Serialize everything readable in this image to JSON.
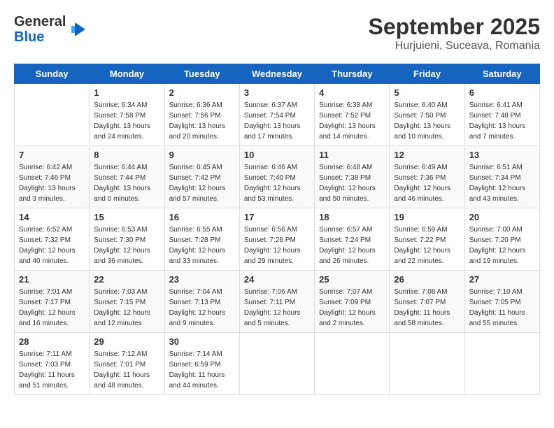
{
  "header": {
    "logo_general": "General",
    "logo_blue": "Blue",
    "month": "September 2025",
    "location": "Hurjuieni, Suceava, Romania"
  },
  "days_of_week": [
    "Sunday",
    "Monday",
    "Tuesday",
    "Wednesday",
    "Thursday",
    "Friday",
    "Saturday"
  ],
  "weeks": [
    [
      {
        "day": "",
        "info": ""
      },
      {
        "day": "1",
        "info": "Sunrise: 6:34 AM\nSunset: 7:58 PM\nDaylight: 13 hours\nand 24 minutes."
      },
      {
        "day": "2",
        "info": "Sunrise: 6:36 AM\nSunset: 7:56 PM\nDaylight: 13 hours\nand 20 minutes."
      },
      {
        "day": "3",
        "info": "Sunrise: 6:37 AM\nSunset: 7:54 PM\nDaylight: 13 hours\nand 17 minutes."
      },
      {
        "day": "4",
        "info": "Sunrise: 6:38 AM\nSunset: 7:52 PM\nDaylight: 13 hours\nand 14 minutes."
      },
      {
        "day": "5",
        "info": "Sunrise: 6:40 AM\nSunset: 7:50 PM\nDaylight: 13 hours\nand 10 minutes."
      },
      {
        "day": "6",
        "info": "Sunrise: 6:41 AM\nSunset: 7:48 PM\nDaylight: 13 hours\nand 7 minutes."
      }
    ],
    [
      {
        "day": "7",
        "info": "Sunrise: 6:42 AM\nSunset: 7:46 PM\nDaylight: 13 hours\nand 3 minutes."
      },
      {
        "day": "8",
        "info": "Sunrise: 6:44 AM\nSunset: 7:44 PM\nDaylight: 13 hours\nand 0 minutes."
      },
      {
        "day": "9",
        "info": "Sunrise: 6:45 AM\nSunset: 7:42 PM\nDaylight: 12 hours\nand 57 minutes."
      },
      {
        "day": "10",
        "info": "Sunrise: 6:46 AM\nSunset: 7:40 PM\nDaylight: 12 hours\nand 53 minutes."
      },
      {
        "day": "11",
        "info": "Sunrise: 6:48 AM\nSunset: 7:38 PM\nDaylight: 12 hours\nand 50 minutes."
      },
      {
        "day": "12",
        "info": "Sunrise: 6:49 AM\nSunset: 7:36 PM\nDaylight: 12 hours\nand 46 minutes."
      },
      {
        "day": "13",
        "info": "Sunrise: 6:51 AM\nSunset: 7:34 PM\nDaylight: 12 hours\nand 43 minutes."
      }
    ],
    [
      {
        "day": "14",
        "info": "Sunrise: 6:52 AM\nSunset: 7:32 PM\nDaylight: 12 hours\nand 40 minutes."
      },
      {
        "day": "15",
        "info": "Sunrise: 6:53 AM\nSunset: 7:30 PM\nDaylight: 12 hours\nand 36 minutes."
      },
      {
        "day": "16",
        "info": "Sunrise: 6:55 AM\nSunset: 7:28 PM\nDaylight: 12 hours\nand 33 minutes."
      },
      {
        "day": "17",
        "info": "Sunrise: 6:56 AM\nSunset: 7:26 PM\nDaylight: 12 hours\nand 29 minutes."
      },
      {
        "day": "18",
        "info": "Sunrise: 6:57 AM\nSunset: 7:24 PM\nDaylight: 12 hours\nand 26 minutes."
      },
      {
        "day": "19",
        "info": "Sunrise: 6:59 AM\nSunset: 7:22 PM\nDaylight: 12 hours\nand 22 minutes."
      },
      {
        "day": "20",
        "info": "Sunrise: 7:00 AM\nSunset: 7:20 PM\nDaylight: 12 hours\nand 19 minutes."
      }
    ],
    [
      {
        "day": "21",
        "info": "Sunrise: 7:01 AM\nSunset: 7:17 PM\nDaylight: 12 hours\nand 16 minutes."
      },
      {
        "day": "22",
        "info": "Sunrise: 7:03 AM\nSunset: 7:15 PM\nDaylight: 12 hours\nand 12 minutes."
      },
      {
        "day": "23",
        "info": "Sunrise: 7:04 AM\nSunset: 7:13 PM\nDaylight: 12 hours\nand 9 minutes."
      },
      {
        "day": "24",
        "info": "Sunrise: 7:06 AM\nSunset: 7:11 PM\nDaylight: 12 hours\nand 5 minutes."
      },
      {
        "day": "25",
        "info": "Sunrise: 7:07 AM\nSunset: 7:09 PM\nDaylight: 12 hours\nand 2 minutes."
      },
      {
        "day": "26",
        "info": "Sunrise: 7:08 AM\nSunset: 7:07 PM\nDaylight: 11 hours\nand 58 minutes."
      },
      {
        "day": "27",
        "info": "Sunrise: 7:10 AM\nSunset: 7:05 PM\nDaylight: 11 hours\nand 55 minutes."
      }
    ],
    [
      {
        "day": "28",
        "info": "Sunrise: 7:11 AM\nSunset: 7:03 PM\nDaylight: 11 hours\nand 51 minutes."
      },
      {
        "day": "29",
        "info": "Sunrise: 7:12 AM\nSunset: 7:01 PM\nDaylight: 11 hours\nand 48 minutes."
      },
      {
        "day": "30",
        "info": "Sunrise: 7:14 AM\nSunset: 6:59 PM\nDaylight: 11 hours\nand 44 minutes."
      },
      {
        "day": "",
        "info": ""
      },
      {
        "day": "",
        "info": ""
      },
      {
        "day": "",
        "info": ""
      },
      {
        "day": "",
        "info": ""
      }
    ]
  ]
}
